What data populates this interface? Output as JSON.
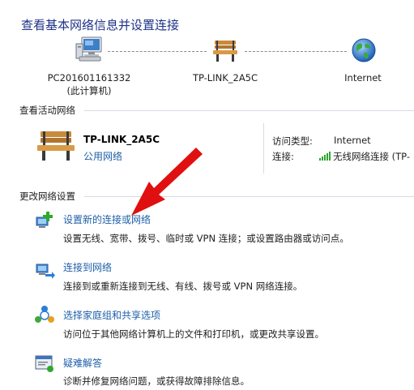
{
  "header": {
    "title": "查看基本网络信息并设置连接"
  },
  "network_map": {
    "computer": {
      "name": "PC201601161332",
      "subtitle": "(此计算机)"
    },
    "router": {
      "name": "TP-LINK_2A5C"
    },
    "internet": {
      "name": "Internet"
    }
  },
  "active_networks": {
    "header": "查看活动网络",
    "network_name": "TP-LINK_2A5C",
    "network_type": "公用网络",
    "access_type_label": "访问类型:",
    "access_type_value": "Internet",
    "connection_label": "连接:",
    "connection_value": "无线网络连接 (TP-"
  },
  "change_settings": {
    "header": "更改网络设置",
    "tasks": [
      {
        "title": "设置新的连接或网络",
        "desc": "设置无线、宽带、拨号、临时或 VPN 连接；或设置路由器或访问点。"
      },
      {
        "title": "连接到网络",
        "desc": "连接到或重新连接到无线、有线、拨号或 VPN 网络连接。"
      },
      {
        "title": "选择家庭组和共享选项",
        "desc": "访问位于其他网络计算机上的文件和打印机，或更改共享设置。"
      },
      {
        "title": "疑难解答",
        "desc": "诊断并修复网络问题，或获得故障排除信息。"
      }
    ]
  },
  "colors": {
    "link": "#1e5fa8",
    "title": "#1e3287",
    "arrow": "#e01010"
  }
}
